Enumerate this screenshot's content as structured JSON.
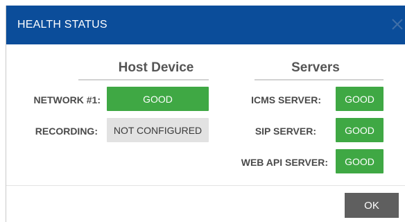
{
  "dialog": {
    "title": "HEALTH STATUS",
    "close_icon": "close-icon",
    "colors": {
      "titlebar": "#0b4d9a",
      "good": "#3fa844",
      "not_configured": "#e2e2e2",
      "ok_button": "#5f5f5f"
    }
  },
  "host_device": {
    "heading": "Host Device",
    "rows": [
      {
        "label": "NETWORK #1:",
        "status": "GOOD"
      },
      {
        "label": "RECORDING:",
        "status": "NOT CONFIGURED"
      }
    ]
  },
  "servers": {
    "heading": "Servers",
    "rows": [
      {
        "label": "ICMS SERVER:",
        "status": "GOOD"
      },
      {
        "label": "SIP SERVER:",
        "status": "GOOD"
      },
      {
        "label": "WEB API SERVER:",
        "status": "GOOD"
      }
    ]
  },
  "footer": {
    "ok_label": "OK"
  }
}
